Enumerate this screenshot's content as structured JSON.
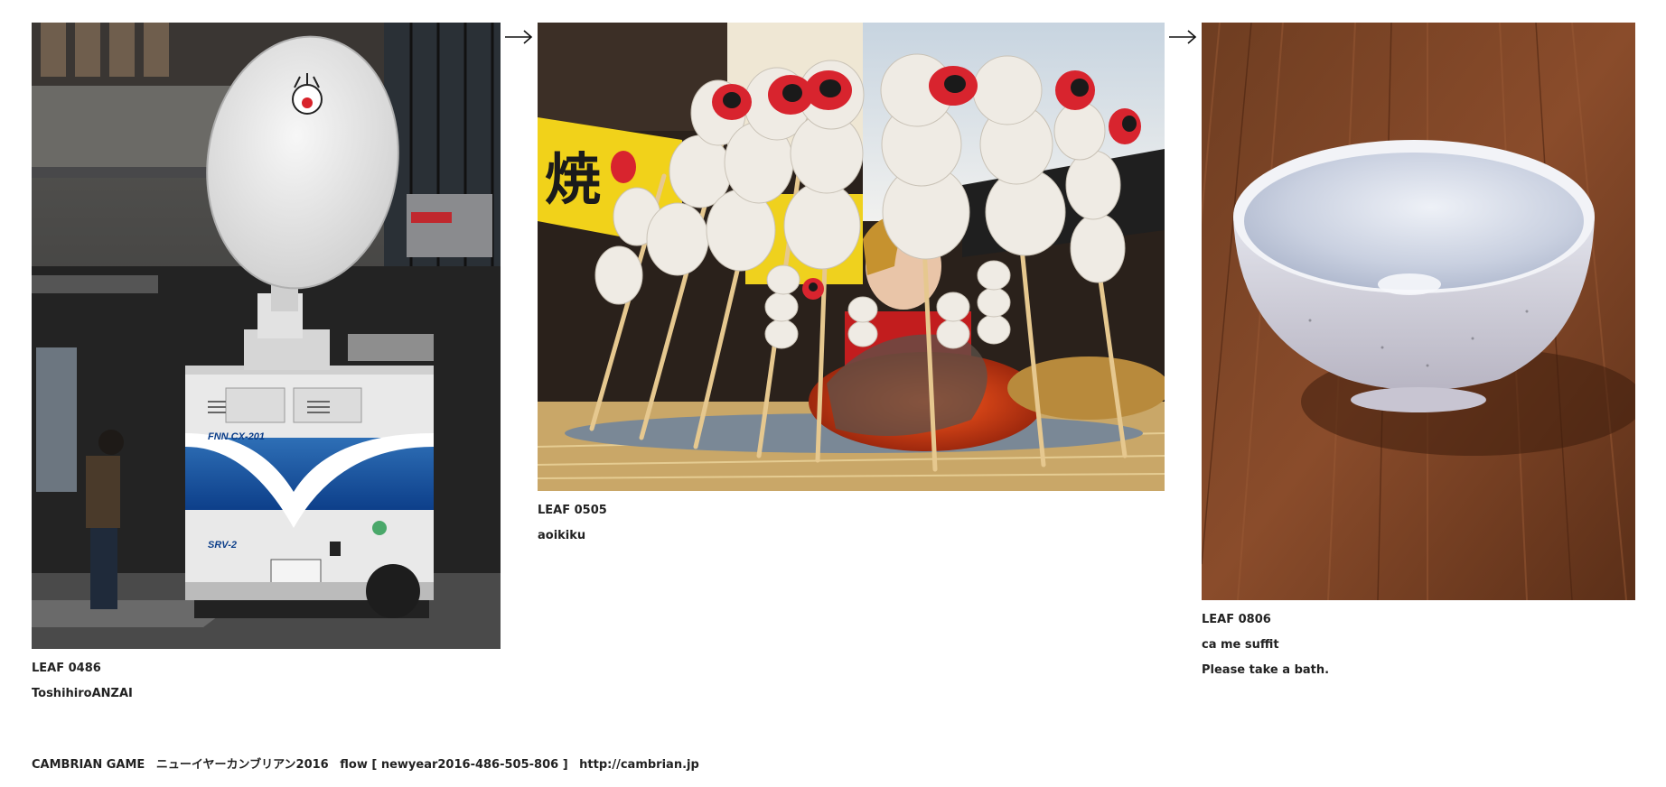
{
  "leaves": [
    {
      "id_label": "LEAF 0486",
      "author": "ToshihiroANZAI",
      "photo_subject": "satellite-broadcast-truck",
      "truck_plate_text": "FNN CX-201",
      "truck_model_text": "SRV-2"
    },
    {
      "id_label": "LEAF 0505",
      "author": "aoikiku",
      "photo_subject": "grilled-dango-skewers"
    },
    {
      "id_label": "LEAF 0806",
      "author": "ca me suffit",
      "note": "Please take a bath.",
      "photo_subject": "ceramic-bowl-on-wooden-table"
    }
  ],
  "footer": {
    "game": "CAMBRIAN GAME",
    "event": "ニューイヤーカンブリアン2016",
    "flow": "flow [ newyear2016-486-505-806 ]",
    "url": "http://cambrian.jp"
  },
  "icons": {
    "flow_arrow": "right-arrow-icon"
  }
}
